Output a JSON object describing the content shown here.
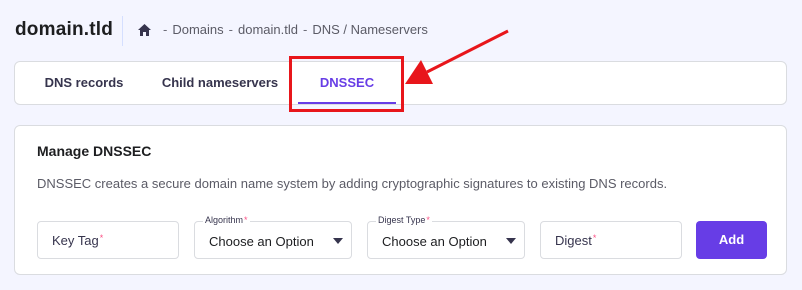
{
  "header": {
    "domain_title": "domain.tld",
    "breadcrumb": {
      "separator": "-",
      "items": [
        "Domains",
        "domain.tld",
        "DNS / Nameservers"
      ]
    }
  },
  "tabs": [
    {
      "label": "DNS records",
      "active": false
    },
    {
      "label": "Child nameservers",
      "active": false
    },
    {
      "label": "DNSSEC",
      "active": true
    }
  ],
  "main": {
    "title": "Manage DNSSEC",
    "description": "DNSSEC creates a secure domain name system by adding cryptographic signatures to existing DNS records.",
    "fields": {
      "key_tag": {
        "placeholder": "Key Tag",
        "required_mark": "*"
      },
      "algorithm": {
        "label": "Algorithm",
        "required_mark": "*",
        "value": "Choose an Option"
      },
      "digest_type": {
        "label": "Digest Type",
        "required_mark": "*",
        "value": "Choose an Option"
      },
      "digest": {
        "placeholder": "Digest",
        "required_mark": "*"
      }
    },
    "add_button": "Add"
  },
  "colors": {
    "accent": "#673de6",
    "annotation": "#e8161b",
    "required": "#fc5185",
    "background": "#f4f5ff"
  },
  "icons": [
    "home-icon",
    "chevron-down-icon"
  ]
}
